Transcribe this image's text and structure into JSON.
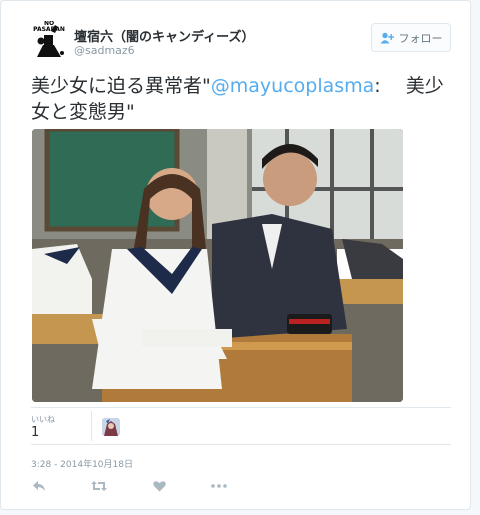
{
  "user": {
    "display_name": "壇宿六（闇のキャンディーズ）",
    "screen_name": "@sadmaz6",
    "avatar_text": "NO PASARAN"
  },
  "follow": {
    "label": "フォロー",
    "icon": "person-plus-icon"
  },
  "tweet": {
    "prefix": "美少女に迫る異常者\"",
    "mention": "@mayucoplasma",
    "rest": ":　 美少女と変態男\""
  },
  "stats": {
    "likes_label": "いいね",
    "likes_count": "1"
  },
  "timestamp": "3:28 - 2014年10月18日",
  "actions": [
    "reply-icon",
    "retweet-icon",
    "like-icon",
    "more-icon"
  ],
  "colors": {
    "accent": "#55acee",
    "text": "#292f33",
    "muted": "#8899a6",
    "border": "#e1e8ed"
  }
}
